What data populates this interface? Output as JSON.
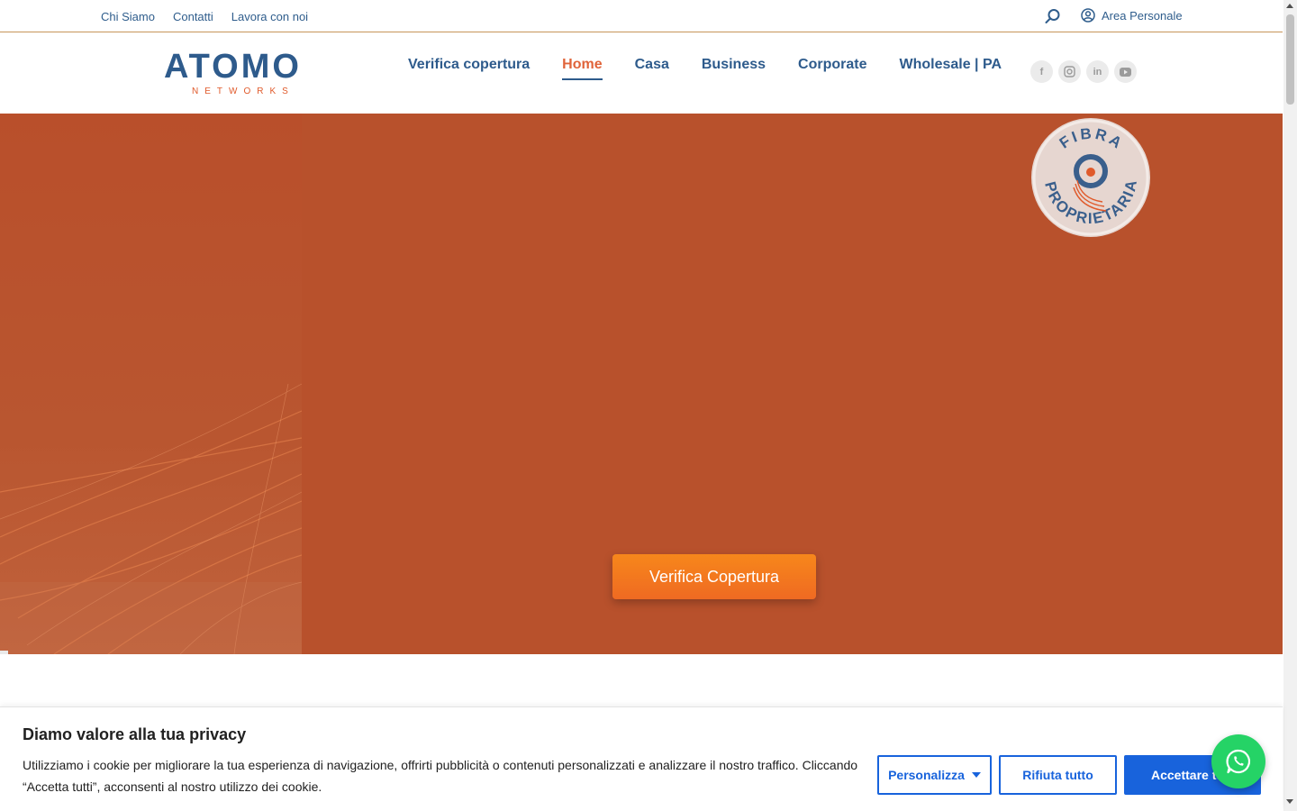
{
  "topbar": {
    "links": [
      "Chi Siamo",
      "Contatti",
      "Lavora con noi"
    ],
    "area_personale": "Area Personale"
  },
  "header": {
    "logo_word": "ATOMO",
    "logo_sub": "NETWORKS",
    "nav": [
      "Verifica copertura",
      "Home",
      "Casa",
      "Business",
      "Corporate",
      "Wholesale | PA"
    ],
    "active_nav": "Home",
    "socials": [
      "facebook-icon",
      "instagram-icon",
      "linkedin-icon",
      "youtube-icon"
    ]
  },
  "hero": {
    "badge_text": "FIBRA PROPRIETARIA",
    "cta_label": "Verifica Copertura"
  },
  "cookie": {
    "title": "Diamo valore alla tua privacy",
    "text": "Utilizziamo i cookie per migliorare la tua esperienza di navigazione, offrirti pubblicità o contenuti personalizzati e analizzare il nostro traffico. Cliccando “Accetta tutti”, acconsenti al nostro utilizzo dei cookie.",
    "personalizza_label": "Personalizza",
    "rifiuta_label": "Rifiuta tutto",
    "accetta_label": "Accettare tutto"
  },
  "colors": {
    "brand_blue": "#2e5b8c",
    "brand_orange": "#e0643a",
    "hero_bg": "#b8512c",
    "cta": "#f47a1f",
    "cookie_blue": "#1863dc",
    "whatsapp": "#25d366"
  }
}
